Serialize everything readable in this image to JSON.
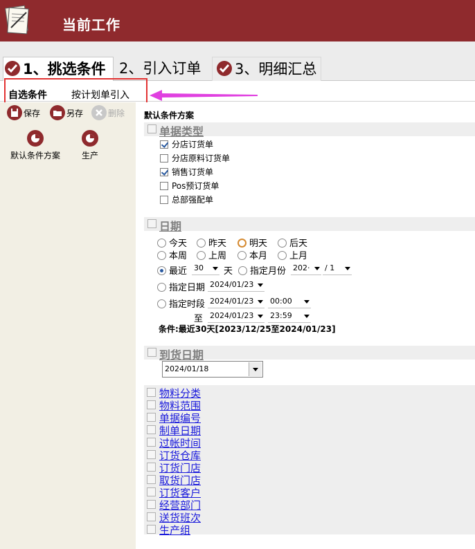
{
  "header": {
    "title": "当前工作"
  },
  "steps": [
    {
      "label": "1、挑选条件"
    },
    {
      "label": "2、引入订单"
    },
    {
      "label": "3、明细汇总"
    }
  ],
  "subtabs": [
    {
      "label": "自选条件"
    },
    {
      "label": "按计划单引入"
    }
  ],
  "toolbar": {
    "save": "保存",
    "save_as": "另存",
    "delete": "删除"
  },
  "schemes": [
    {
      "label": "默认条件方案"
    },
    {
      "label": "生产"
    }
  ],
  "main": {
    "scheme_title": "默认条件方案",
    "doc_type": {
      "title": "单据类型",
      "options": [
        {
          "label": "分店订货单",
          "checked": true
        },
        {
          "label": "分店原料订货单",
          "checked": false
        },
        {
          "label": "销售订货单",
          "checked": true
        },
        {
          "label": "Pos预订货单",
          "checked": false
        },
        {
          "label": "总部强配单",
          "checked": false
        }
      ]
    },
    "date": {
      "title": "日期",
      "row1": [
        "今天",
        "昨天",
        "明天",
        "后天"
      ],
      "row2": [
        "本周",
        "上周",
        "本月",
        "上月"
      ],
      "recent_label": "最近",
      "recent_value": "30",
      "days_unit": "天",
      "month_label": "指定月份",
      "month_year": "202·",
      "month_value": "/ 1",
      "specify_date_label": "指定日期",
      "specify_date_value": "2024/01/23",
      "period_label": "指定时段",
      "period_from_date": "2024/01/23",
      "period_from_time": "00:00",
      "to_label": "至",
      "period_to_date": "2024/01/23",
      "period_to_time": "23:59",
      "condition": "条件:最近30天[2023/12/25至2024/01/23]"
    },
    "arrival": {
      "title": "到货日期",
      "value": "2024/01/18"
    },
    "filters": [
      "物料分类",
      "物料范围",
      "单据编号",
      "制单日期",
      "过帐时间",
      "订货仓库",
      "订货门店",
      "取货门店",
      "订货客户",
      "经营部门",
      "送货班次",
      "生产组"
    ]
  },
  "colors": {
    "brand": "#8f2a2d",
    "highlight": "#e23232",
    "arrow": "#e040e0",
    "link": "#1a1adc"
  }
}
